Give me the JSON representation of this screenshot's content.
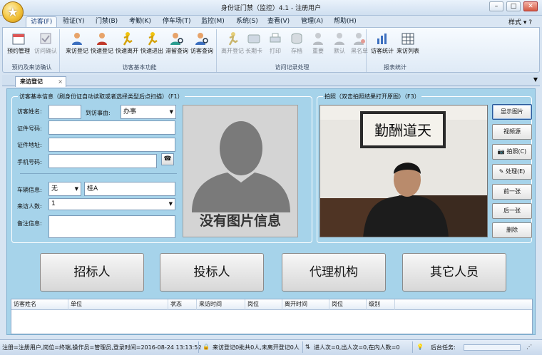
{
  "window": {
    "title": "身份证门禁（监控）4.1 - 注册用户",
    "style_menu": "样式"
  },
  "menu": [
    "访客(F)",
    "验证(Y)",
    "门禁(B)",
    "考勤(K)",
    "停车场(T)",
    "监控(M)",
    "系统(S)",
    "查看(V)",
    "管理(A)",
    "帮助(H)"
  ],
  "ribbon": {
    "groups": [
      {
        "label": "预约及来访确认",
        "buttons": [
          "预约管理",
          "访问确认"
        ]
      },
      {
        "label": "访客基本功能",
        "buttons": [
          "来访登记",
          "快速登记",
          "快速离开",
          "快速进出",
          "滞留查询",
          "访客查询"
        ]
      },
      {
        "label": "访问记录处理",
        "buttons": [
          "离开登记",
          "长期卡",
          "打印",
          "存档",
          "重要",
          "默认",
          "黑名单"
        ]
      },
      {
        "label": "报表统计",
        "buttons": [
          "访客统计",
          "来访列表"
        ]
      }
    ]
  },
  "doc_tab": {
    "label": "来访登记",
    "close": "×"
  },
  "visitor_info": {
    "legend": "访客基本信息（刷身份证自动读取或者选择类型后点扫描）（F1）",
    "name_label": "访客姓名:",
    "name_value": "",
    "reason_label": "到访事由:",
    "reason_value": "办事",
    "id_label": "证件号码:",
    "id_value": "",
    "address_label": "证件地址:",
    "address_value": "",
    "phone_label": "手机号码:",
    "phone_value": "",
    "vehicle_label": "车辆信息:",
    "vehicle_value": "无",
    "plate_value": "桂A",
    "count_label": "来访人数:",
    "count_value": "1",
    "remark_label": "备注信息:",
    "remark_value": "",
    "no_photo_text": "没有图片信息"
  },
  "camera": {
    "legend": "拍照（双击拍照结果打开原图）（F3）",
    "calligraphy": "勤酬道天",
    "buttons": [
      "显示图片",
      "视频源",
      "拍照(C)",
      "处理(E)",
      "前一张",
      "后一张",
      "删除"
    ]
  },
  "categories": [
    "招标人",
    "投标人",
    "代理机构",
    "其它人员"
  ],
  "table": {
    "columns": [
      "访客姓名",
      "单位",
      "状态",
      "来访时间",
      "岗位",
      "离开时间",
      "岗位",
      "级别"
    ]
  },
  "status": {
    "user": "注册=注册用户,岗位=终端,操作员=管理员,登录时间=2016-08-24 13:13:52",
    "visits": "来访登记0批共0人,未离开登记0人",
    "inout": "进人次=0,出人次=0,在内人数=0",
    "tasks": "后台任务:"
  },
  "colors": {
    "panel_bg": "#a6d3ea",
    "ribbon_bg": "#dfeaf6",
    "accent": "#1a3e7a"
  }
}
